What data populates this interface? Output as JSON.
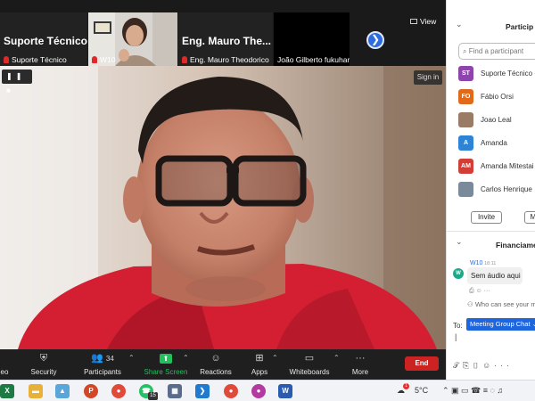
{
  "strip": {
    "tiles": [
      {
        "big_name": "Suporte Técnico",
        "name": "Suporte Técnico"
      },
      {
        "name": "W10"
      },
      {
        "big_name": "Eng. Mauro  The...",
        "name": "Eng. Mauro Theodorico"
      },
      {
        "name": "João Gilberto fukuhara"
      }
    ],
    "view_label": "View"
  },
  "video": {
    "pause_glyphs": "❚❚ ■",
    "sign_in_label": "Sign in"
  },
  "toolbar": {
    "items": [
      {
        "label": "eo",
        "icon": "video-icon"
      },
      {
        "label": "Security",
        "icon": "shield-icon"
      },
      {
        "label": "Participants",
        "icon": "participants-icon",
        "count": "34"
      },
      {
        "label": "Share Screen",
        "icon": "share-screen-icon"
      },
      {
        "label": "Reactions",
        "icon": "reactions-icon"
      },
      {
        "label": "Apps",
        "icon": "apps-icon"
      },
      {
        "label": "Whiteboards",
        "icon": "whiteboard-icon"
      },
      {
        "label": "More",
        "icon": "more-icon"
      }
    ],
    "end_label": "End",
    "share_accent": "#1fc15a",
    "end_color": "#cc2222"
  },
  "panel": {
    "participants_title": "Particip",
    "search_placeholder": "Find a participant",
    "participants": [
      {
        "initials": "ST",
        "name": "Suporte Técnico (",
        "color": "#8e44ad"
      },
      {
        "initials": "FO",
        "name": "Fábio Orsi",
        "color": "#e06a1a"
      },
      {
        "initials": "",
        "name": "Joao Leal",
        "color": "#9a7b66"
      },
      {
        "initials": "A",
        "name": "Amanda",
        "color": "#2d83d6"
      },
      {
        "initials": "AM",
        "name": "Amanda Mitestai",
        "color": "#d23d36"
      },
      {
        "initials": "",
        "name": "Carlos Henrique",
        "color": "#7a8a9a"
      }
    ],
    "invite_label": "Invite",
    "mute_label": "M",
    "chat_title": "Financiame",
    "chat_sender": "W10",
    "chat_time": "18:11",
    "chat_message": "Sem áudio aqui",
    "chat_actions": "⎙  ☺  ···",
    "who_can_see": "Who can see your m",
    "to_label": "To:",
    "to_value": "Meeting Group Chat",
    "input_cursor": "|"
  },
  "taskbar": {
    "apps": [
      {
        "name": "Excel",
        "glyph": "X",
        "color": "#1d7a45"
      },
      {
        "name": "File Explorer",
        "glyph": "▬",
        "color": "#e8b23a"
      },
      {
        "name": "Photos",
        "glyph": "▲",
        "color": "#5aa6d8"
      },
      {
        "name": "PowerPoint",
        "glyph": "P",
        "color": "#d24726"
      },
      {
        "name": "Chrome",
        "glyph": "●",
        "color": "#e04a3a"
      },
      {
        "name": "WhatsApp",
        "glyph": "☎",
        "color": "#25c265"
      },
      {
        "name": "Network",
        "glyph": "▦",
        "color": "#5b6b8a"
      },
      {
        "name": "VS Code",
        "glyph": "❯",
        "color": "#1f7ad0"
      },
      {
        "name": "Chrome 2",
        "glyph": "●",
        "color": "#e04a3a"
      },
      {
        "name": "Chrome 3",
        "glyph": "●",
        "color": "#b23aa0"
      },
      {
        "name": "Word",
        "glyph": "W",
        "color": "#2b5bb0"
      }
    ],
    "whatsapp_badge": "15",
    "weather_badge": "1",
    "temperature": "5°C",
    "tray_glyphs": "⌃  ▣  ▭  ☎  ≡  ◌  ♫"
  }
}
